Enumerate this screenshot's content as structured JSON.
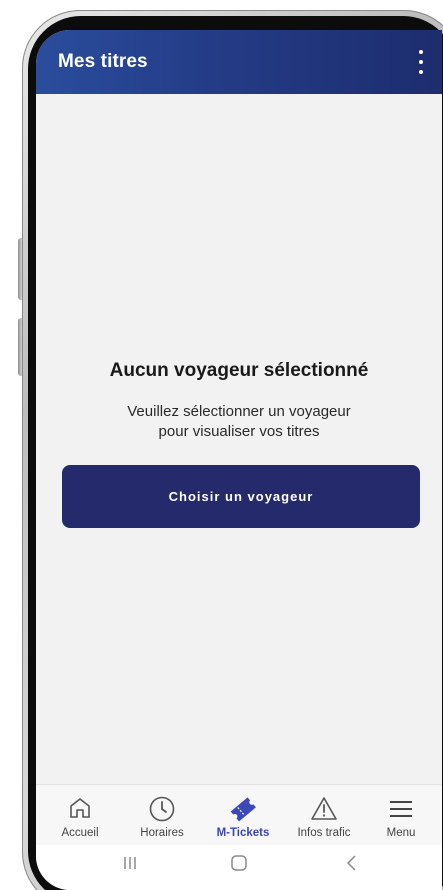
{
  "app_bar": {
    "title": "Mes titres",
    "menu_icon": "more-vertical-icon"
  },
  "empty_state": {
    "title": "Aucun voyageur sélectionné",
    "line1": "Veuillez sélectionner un voyageur",
    "line2": "pour visualiser vos titres",
    "button_label": "Choisir un voyageur"
  },
  "bottom_nav": {
    "active_color": "#3a48b8",
    "items": [
      {
        "label": "Accueil",
        "icon": "home-icon"
      },
      {
        "label": "Horaires",
        "icon": "clock-icon"
      },
      {
        "label": "M-Tickets",
        "icon": "ticket-icon",
        "active": true
      },
      {
        "label": "Infos trafic",
        "icon": "warning-icon"
      },
      {
        "label": "Menu",
        "icon": "hamburger-icon"
      }
    ]
  },
  "system_nav": {
    "recents_icon": "recents-icon",
    "home_icon": "system-home-icon",
    "back_icon": "back-icon"
  },
  "colors": {
    "app_bar_start": "#2a4d9c",
    "app_bar_end": "#1d2d6e",
    "button": "#242a6b",
    "screen_bg": "#f2f2f2"
  }
}
